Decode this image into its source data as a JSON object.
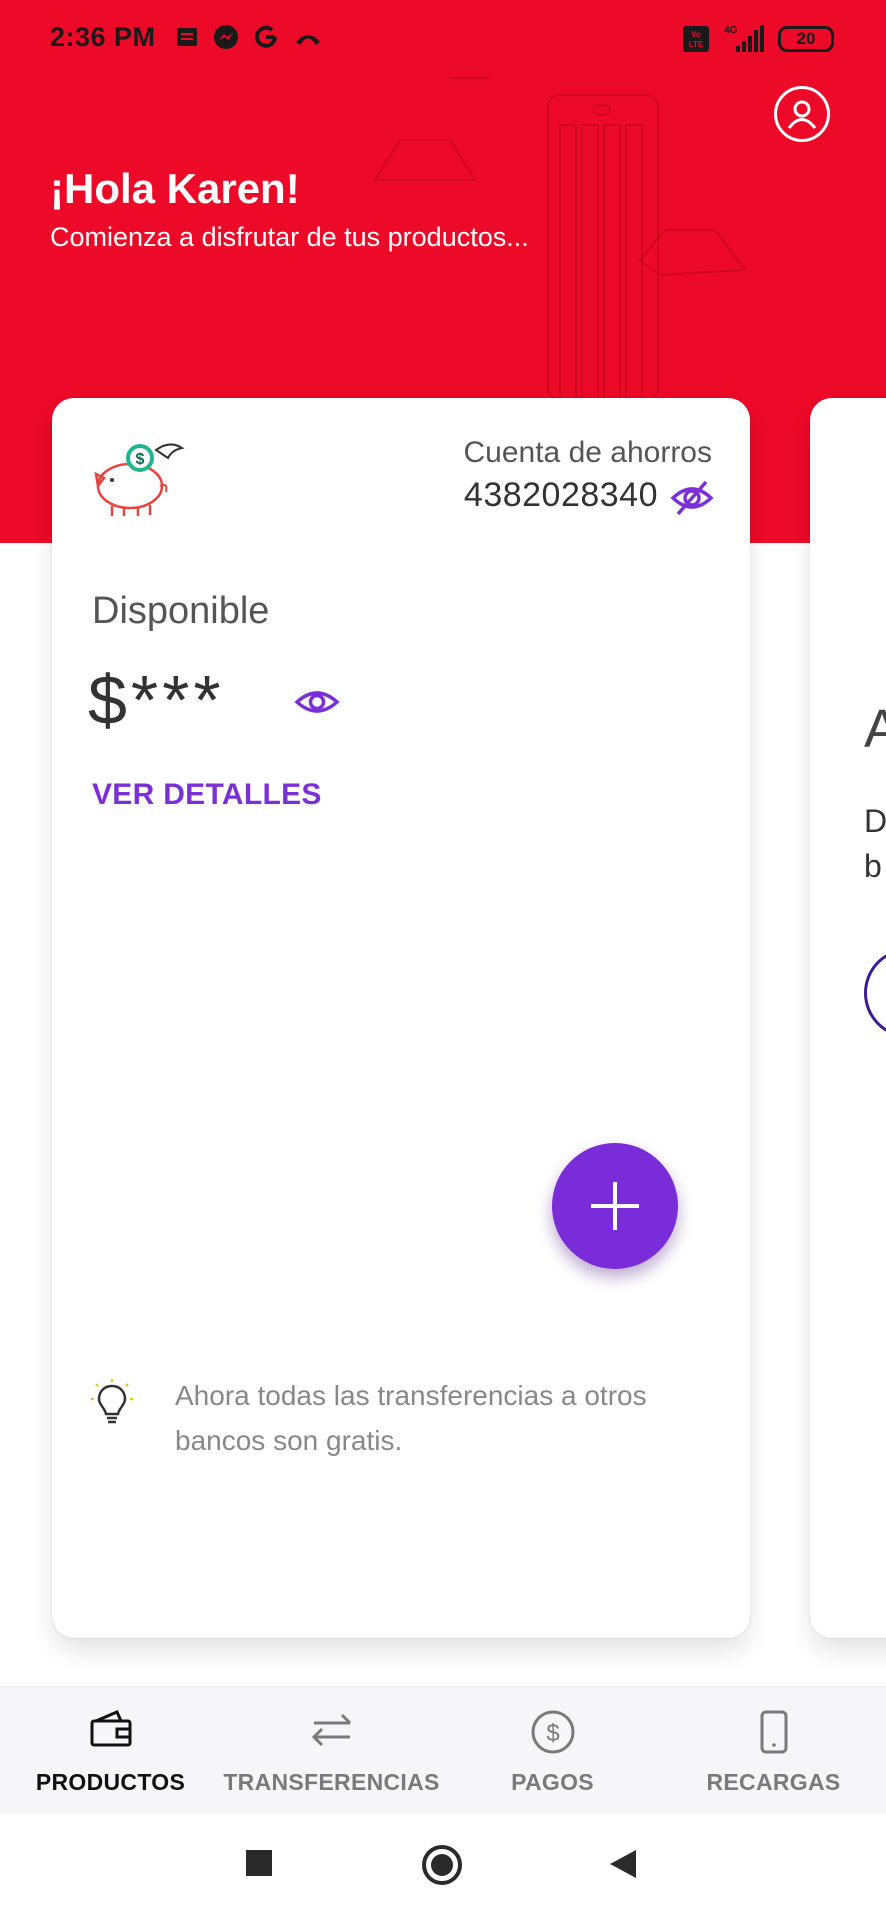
{
  "status_bar": {
    "time": "2:36 PM",
    "battery": "20",
    "network": "4G"
  },
  "header": {
    "greeting": "¡Hola Karen!",
    "subtitle": "Comienza a disfrutar de tus productos..."
  },
  "account_card": {
    "account_type": "Cuenta de ahorros",
    "account_number": "4382028340",
    "available_label": "Disponible",
    "balance": "$***",
    "details_link": "VER DETALLES",
    "tip": "Ahora todas las transferencias a otros bancos son gratis."
  },
  "peek_card": {
    "line1": "A",
    "line2": "D",
    "line3": "b"
  },
  "bottom_nav": {
    "items": [
      {
        "label": "PRODUCTOS",
        "icon": "wallet-icon",
        "active": true
      },
      {
        "label": "TRANSFERENCIAS",
        "icon": "transfer-arrows-icon",
        "active": false
      },
      {
        "label": "PAGOS",
        "icon": "dollar-coin-icon",
        "active": false
      },
      {
        "label": "RECARGAS",
        "icon": "mobile-phone-icon",
        "active": false
      }
    ]
  },
  "colors": {
    "brand_red": "#ec0a28",
    "accent_purple": "#7b2cd9"
  }
}
